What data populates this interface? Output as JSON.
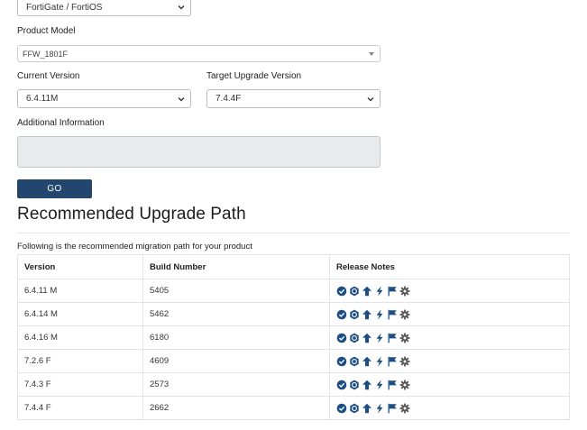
{
  "form": {
    "product_select_value": "FortiGate / FortiOS",
    "product_model_label": "Product Model",
    "product_model_value": "FFW_1801F",
    "current_version_label": "Current Version",
    "current_version_value": "6.4.11M",
    "target_version_label": "Target Upgrade Version",
    "target_version_value": "7.4.4F",
    "additional_info_label": "Additional Information",
    "additional_info_value": "",
    "go_label": "GO"
  },
  "results": {
    "title": "Recommended Upgrade Path",
    "subtitle": "Following is the recommended migration path for your product",
    "columns": [
      "Version",
      "Build Number",
      "Release Notes"
    ],
    "rows": [
      {
        "version": "6.4.11 M",
        "build": "5405"
      },
      {
        "version": "6.4.14 M",
        "build": "5462"
      },
      {
        "version": "6.4.16 M",
        "build": "6180"
      },
      {
        "version": "7.2.6 F",
        "build": "4609"
      },
      {
        "version": "7.4.3 F",
        "build": "2573"
      },
      {
        "version": "7.4.4 F",
        "build": "2662"
      }
    ],
    "release_note_icons": [
      "check-badge-icon",
      "hexagon-badge-icon",
      "arrow-up-icon",
      "lightning-icon",
      "flag-icon",
      "gear-icon"
    ]
  },
  "colors": {
    "brand_blue": "#22466e",
    "icon_blue": "#1c4e85",
    "icon_gray": "#555555"
  }
}
